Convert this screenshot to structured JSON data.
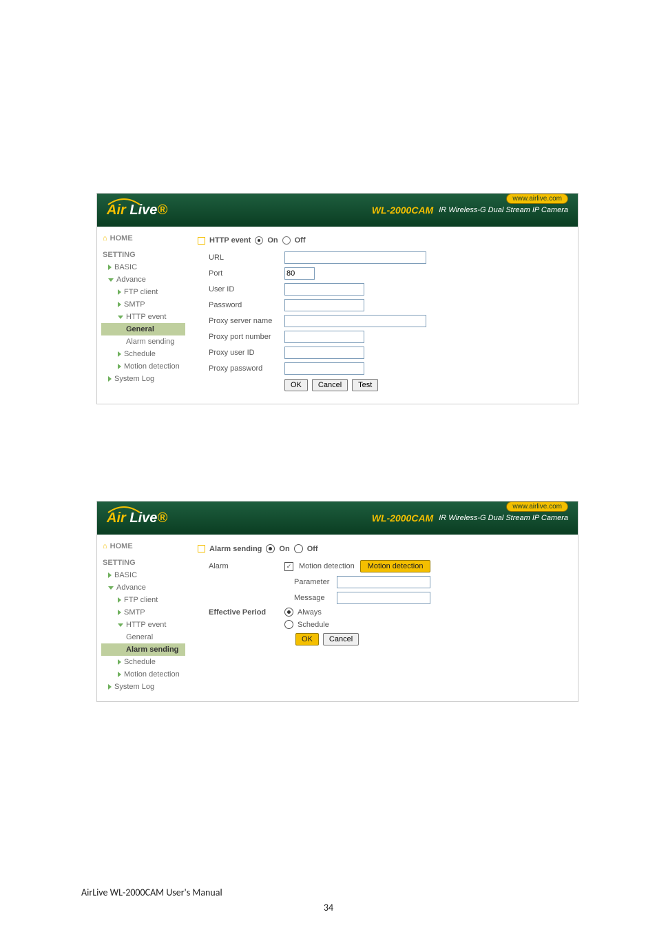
{
  "brand": {
    "logo_prefix": "Air",
    "logo_suffix": " Live",
    "model": "WL-2000CAM",
    "tagline": "IR Wireless-G Dual Stream IP Camera",
    "badge": "www.airlive.com"
  },
  "sidebar": {
    "home": "HOME",
    "setting": "SETTING",
    "basic": "BASIC",
    "advance": "Advance",
    "ftp": "FTP client",
    "smtp": "SMTP",
    "httpevent": "HTTP event",
    "general": "General",
    "alarm_sending": "Alarm sending",
    "schedule": "Schedule",
    "motion": "Motion detection",
    "syslog": "System Log"
  },
  "panel1": {
    "title": "HTTP event",
    "on": "On",
    "off": "Off",
    "fields": {
      "url": "URL",
      "port": "Port",
      "port_value": "80",
      "userid": "User ID",
      "password": "Password",
      "proxy_server": "Proxy server name",
      "proxy_port": "Proxy port number",
      "proxy_user": "Proxy user ID",
      "proxy_password": "Proxy password"
    },
    "buttons": {
      "ok": "OK",
      "cancel": "Cancel",
      "test": "Test"
    }
  },
  "panel2": {
    "title": "Alarm sending",
    "on": "On",
    "off": "Off",
    "alarm_label": "Alarm",
    "motion_label": "Motion detection",
    "motion_button": "Motion detection",
    "parameter": "Parameter",
    "message": "Message",
    "eff_label": "Effective Period",
    "always": "Always",
    "schedule": "Schedule",
    "buttons": {
      "ok": "OK",
      "cancel": "Cancel"
    }
  },
  "footer": "AirLive WL-2000CAM User's Manual",
  "page_number": "34"
}
